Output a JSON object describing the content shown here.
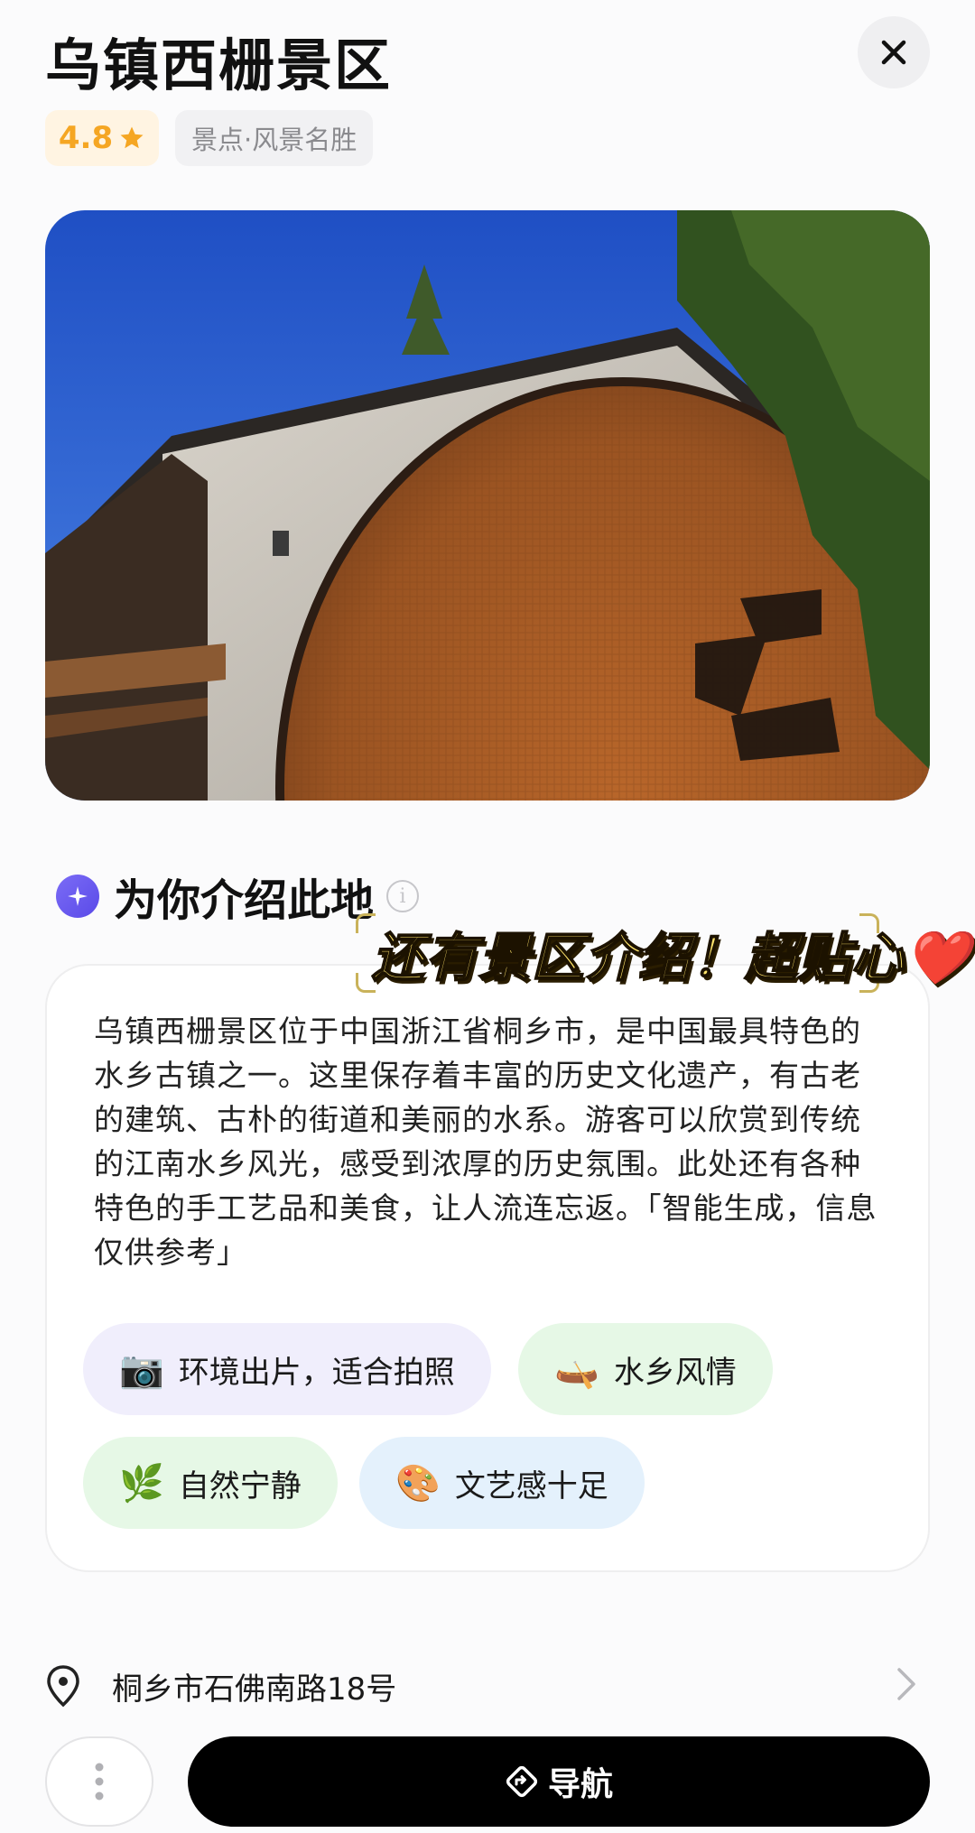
{
  "header": {
    "title": "乌镇西栅景区",
    "close_icon": "close-icon",
    "rating": "4.8",
    "rating_icon": "star-icon",
    "category": "景点·风景名胜"
  },
  "intro": {
    "heading": "为你介绍此地",
    "badge_icon": "ai-sparkle-icon",
    "info_icon": "info-icon",
    "description": "乌镇西栅景区位于中国浙江省桐乡市，是中国最具特色的水乡古镇之一。这里保存着丰富的历史文化遗产，有古老的建筑、古朴的街道和美丽的水系。游客可以欣赏到传统的江南水乡风光，感受到浓厚的历史氛围。此处还有各种特色的手工艺品和美食，让人流连忘返。「智能生成，信息仅供参考」",
    "tags": [
      {
        "emoji": "📷",
        "label": "环境出片，适合拍照"
      },
      {
        "emoji": "🛶",
        "label": "水乡风情"
      },
      {
        "emoji": "🌿",
        "label": "自然宁静"
      },
      {
        "emoji": "🎨",
        "label": "文艺感十足"
      }
    ]
  },
  "overlay_caption": "还有景区介绍！超贴心❤️",
  "address": {
    "icon": "location-pin-icon",
    "text": "桐乡市石佛南路18号"
  },
  "actions": {
    "more_icon": "more-vertical-icon",
    "navigate_label": "导航",
    "navigate_icon": "navigation-icon"
  },
  "colors": {
    "rating": "#f5a623",
    "tag_photo_bg": "#f0eefc",
    "tag_water_bg": "#e6f8e6",
    "tag_nature_bg": "#e6f8e6",
    "tag_art_bg": "#e4f1fc",
    "nav_button_bg": "#000000"
  }
}
